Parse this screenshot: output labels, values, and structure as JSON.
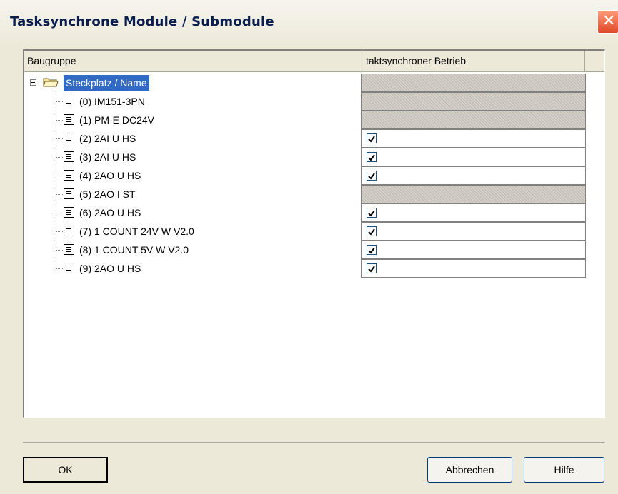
{
  "window": {
    "title": "Tasksynchrone Module / Submodule",
    "close_glyph": "✕"
  },
  "columns": {
    "module": "Baugruppe",
    "sync": "taktsynchroner Betrieb"
  },
  "root": {
    "label": "Steckplatz / Name",
    "icon": "folder-icon",
    "selected": true,
    "sync": "disabled"
  },
  "rows": [
    {
      "label": "(0) IM151-3PN",
      "sync": "disabled"
    },
    {
      "label": "(1) PM-E DC24V",
      "sync": "disabled"
    },
    {
      "label": "(2) 2AI U HS",
      "sync": "checked"
    },
    {
      "label": "(3) 2AI U HS",
      "sync": "checked"
    },
    {
      "label": "(4) 2AO U HS",
      "sync": "checked"
    },
    {
      "label": "(5) 2AO I ST",
      "sync": "disabled"
    },
    {
      "label": "(6) 2AO U HS",
      "sync": "checked"
    },
    {
      "label": "(7) 1 COUNT 24V W V2.0",
      "sync": "checked"
    },
    {
      "label": "(8) 1 COUNT 5V W V2.0",
      "sync": "checked"
    },
    {
      "label": "(9) 2AO U HS",
      "sync": "checked"
    }
  ],
  "buttons": {
    "ok": "OK",
    "cancel": "Abbrechen",
    "help": "Hilfe"
  },
  "colors": {
    "selection": "#316ac5",
    "dialog_bg": "#ece9d8",
    "close_red": "#e0482a"
  }
}
